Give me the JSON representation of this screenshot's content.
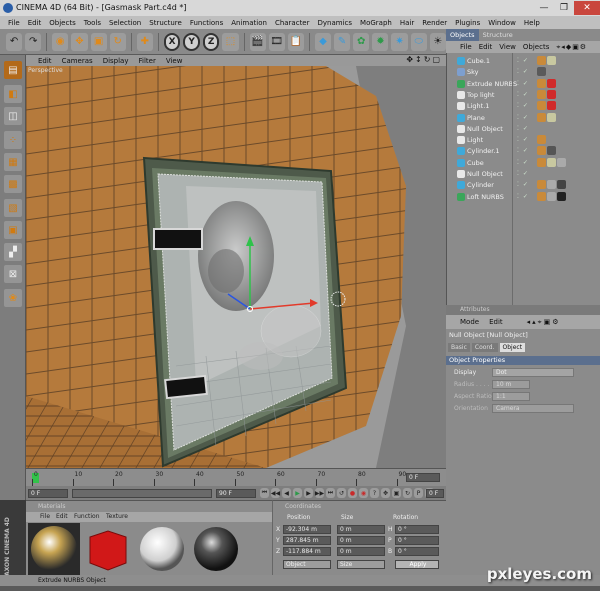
{
  "window": {
    "title": "CINEMA 4D (64 Bit) - [Gasmask Part.c4d *]",
    "controls": [
      "—",
      "❐",
      "✕"
    ]
  },
  "menubar": [
    "File",
    "Edit",
    "Objects",
    "Tools",
    "Selection",
    "Structure",
    "Functions",
    "Animation",
    "Character",
    "Dynamics",
    "MoGraph",
    "Hair",
    "Render",
    "Plugins",
    "Window",
    "Help"
  ],
  "viewport": {
    "menu": [
      "Edit",
      "Cameras",
      "Display",
      "Filter",
      "View"
    ],
    "camera_label": "Perspective"
  },
  "timeline": {
    "ticks": [
      "0",
      "10",
      "20",
      "30",
      "40",
      "50",
      "60",
      "70",
      "80",
      "90"
    ],
    "end_field": "0 F",
    "start_field": "0 F",
    "range_field": "90 F",
    "right_field": "90 F",
    "end_frame": "0 F"
  },
  "objects_panel": {
    "tabs": [
      "Objects",
      "Structure"
    ],
    "menu": [
      "File",
      "Edit",
      "View",
      "Objects"
    ],
    "items": [
      {
        "name": "Cube.1",
        "icon": "#3fa9d9"
      },
      {
        "name": "Sky",
        "icon": "#7d9fcf"
      },
      {
        "name": "Extrude NURBS",
        "icon": "#3aa65a"
      },
      {
        "name": "Top light",
        "icon": "#e8e8e8"
      },
      {
        "name": "Light.1",
        "icon": "#e8e8e8"
      },
      {
        "name": "Plane",
        "icon": "#3fa9d9"
      },
      {
        "name": "Null Object",
        "icon": "#e8e8e8"
      },
      {
        "name": "Light",
        "icon": "#e8e8e8"
      },
      {
        "name": "Cylinder.1",
        "icon": "#3fa9d9"
      },
      {
        "name": "Cube",
        "icon": "#3fa9d9"
      },
      {
        "name": "Null Object",
        "icon": "#e8e8e8"
      },
      {
        "name": "Cylinder",
        "icon": "#3fa9d9"
      },
      {
        "name": "Loft NURBS",
        "icon": "#3aa65a"
      }
    ]
  },
  "attributes_panel": {
    "header": "Attributes",
    "menu": [
      "Mode",
      "Edit"
    ],
    "title": "Null Object [Null Object]",
    "tabs": [
      "Basic",
      "Coord.",
      "Object"
    ],
    "section": "Object Properties",
    "rows": [
      {
        "label": "Display",
        "value": "Dot"
      },
      {
        "label": "Radius . . . . . .",
        "value": "10 m"
      },
      {
        "label": "Aspect Ratio",
        "value": "1:1"
      },
      {
        "label": "Orientation",
        "value": "Camera"
      }
    ]
  },
  "materials": {
    "header": "Materials",
    "menu": [
      "File",
      "Edit",
      "Function",
      "Texture"
    ]
  },
  "coordinates": {
    "header": "Coordinates",
    "columns": [
      "Position",
      "Size",
      "Rotation"
    ],
    "rows": [
      {
        "axis": "X",
        "pos": "-92.304 m",
        "size": "0 m",
        "rot_axis": "H",
        "rot": "0 °"
      },
      {
        "axis": "Y",
        "pos": "287.845 m",
        "size": "0 m",
        "rot_axis": "P",
        "rot": "0 °"
      },
      {
        "axis": "Z",
        "pos": "-117.884 m",
        "size": "0 m",
        "rot_axis": "B",
        "rot": "0 °"
      }
    ],
    "mode_left": "Object",
    "mode_mid": "Size",
    "apply_label": "Apply"
  },
  "statusbar": "Extrude NURBS Object",
  "brand": "MAXON CINEMA 4D",
  "watermark": "pxleyes.com"
}
